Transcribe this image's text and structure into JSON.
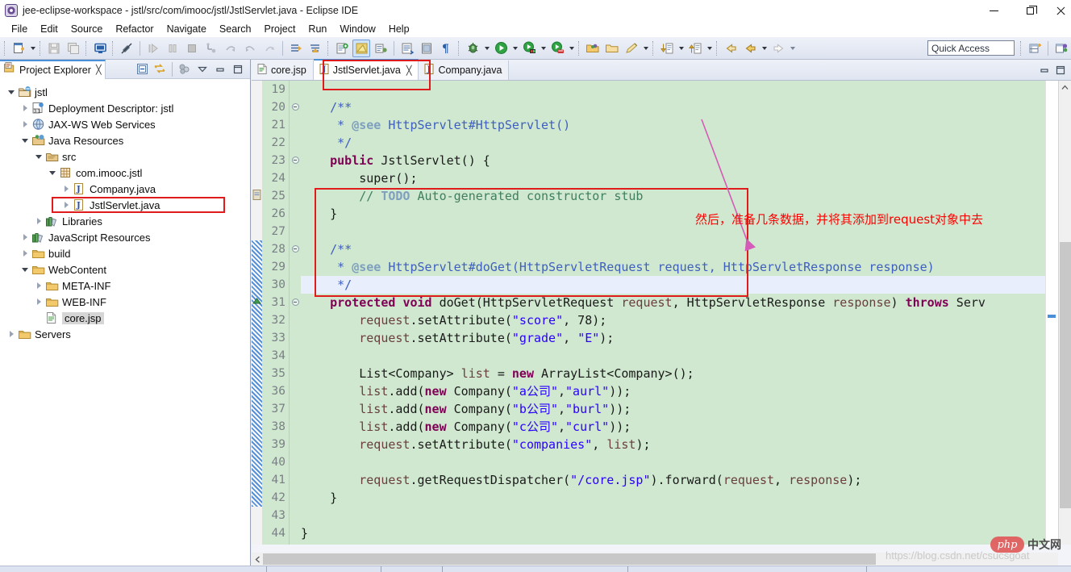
{
  "window": {
    "title": "jee-eclipse-workspace - jstl/src/com/imooc/jstl/JstlServlet.java - Eclipse IDE",
    "app_icon": "eclipse-icon",
    "controls": {
      "minimize": "minimize-icon",
      "maximize": "maximize-icon",
      "close": "close-icon"
    }
  },
  "menubar": {
    "items": [
      "File",
      "Edit",
      "Source",
      "Refactor",
      "Navigate",
      "Search",
      "Project",
      "Run",
      "Window",
      "Help"
    ]
  },
  "toolbar": {
    "quick_access_placeholder": "Quick Access",
    "buttons": [
      "new-wizard-icon",
      "new-dropdown-caret",
      "save-icon",
      "save-all-icon",
      "new-console-icon",
      "toggle-breakpoint-icon",
      "step-over-icon",
      "pause-icon",
      "terminate-icon",
      "step-into-icon",
      "step-return-icon",
      "resume-icon",
      "step-filter-icon",
      "next-annotation-icon",
      "previous-annotation-icon",
      "open-type-icon",
      "open-task-icon",
      "show-whitespace-icon",
      "debug-icon",
      "debug-caret",
      "run-icon",
      "run-caret",
      "run-server-icon",
      "server-caret",
      "profile-icon",
      "profile-caret",
      "open-folder-icon",
      "external-tools-icon",
      "pencil-icon",
      "pencil-caret",
      "import-icon",
      "import-caret",
      "export-icon",
      "export-caret",
      "back-icon",
      "back-history-icon",
      "back-caret",
      "forward-icon",
      "forward-caret",
      "new-perspective-icon",
      "open-perspective-icon"
    ]
  },
  "project_explorer": {
    "tab_label": "Project Explorer",
    "tab_icon": "project-explorer-icon",
    "tab_close": "╳",
    "tools": [
      "collapse-all-icon",
      "link-with-editor-icon",
      "view-menu-dots-icon",
      "filter-caret-icon",
      "minimize-view-icon",
      "maximize-view-icon"
    ],
    "tree": [
      {
        "label": "jstl",
        "indent": 0,
        "twist": "down",
        "icon": "java-project-icon"
      },
      {
        "label": "Deployment Descriptor: jstl",
        "indent": 1,
        "twist": "right",
        "icon": "deployment-descriptor-icon"
      },
      {
        "label": "JAX-WS Web Services",
        "indent": 1,
        "twist": "right",
        "icon": "jaxws-icon"
      },
      {
        "label": "Java Resources",
        "indent": 1,
        "twist": "down",
        "icon": "java-resources-icon"
      },
      {
        "label": "src",
        "indent": 2,
        "twist": "down",
        "icon": "source-folder-icon"
      },
      {
        "label": "com.imooc.jstl",
        "indent": 3,
        "twist": "down",
        "icon": "package-icon"
      },
      {
        "label": "Company.java",
        "indent": 4,
        "twist": "right",
        "icon": "java-file-icon"
      },
      {
        "label": "JstlServlet.java",
        "indent": 4,
        "twist": "right",
        "icon": "java-file-icon",
        "highlighted": true
      },
      {
        "label": "Libraries",
        "indent": 2,
        "twist": "right",
        "icon": "libraries-icon"
      },
      {
        "label": "JavaScript Resources",
        "indent": 1,
        "twist": "right",
        "icon": "libraries-icon"
      },
      {
        "label": "build",
        "indent": 1,
        "twist": "right",
        "icon": "folder-icon"
      },
      {
        "label": "WebContent",
        "indent": 1,
        "twist": "down",
        "icon": "folder-icon"
      },
      {
        "label": "META-INF",
        "indent": 2,
        "twist": "right",
        "icon": "folder-icon"
      },
      {
        "label": "WEB-INF",
        "indent": 2,
        "twist": "right",
        "icon": "folder-icon"
      },
      {
        "label": "core.jsp",
        "indent": 2,
        "twist": "none",
        "icon": "jsp-file-icon",
        "selected": true
      },
      {
        "label": "Servers",
        "indent": 0,
        "twist": "right",
        "icon": "folder-icon"
      }
    ]
  },
  "editor": {
    "tabs": [
      {
        "label": "core.jsp",
        "icon": "jsp-file-icon",
        "active": false,
        "closable": false
      },
      {
        "label": "JstlServlet.java",
        "icon": "java-file-icon",
        "active": true,
        "closable": true,
        "close_glyph": "╳",
        "highlighted": true
      },
      {
        "label": "Company.java",
        "icon": "java-file-icon",
        "active": false,
        "closable": false
      }
    ],
    "tools": [
      "minimize-editor-icon",
      "maximize-editor-icon"
    ],
    "first_visible_line": 19,
    "last_visible_line": 44,
    "caret_line": 30,
    "highlighted_line": 30,
    "folded_lines": [
      20,
      23,
      28,
      31
    ],
    "lines": [
      {
        "n": 19,
        "text": ""
      },
      {
        "n": 20,
        "text": "    /**"
      },
      {
        "n": 21,
        "text": "     * @see HttpServlet#HttpServlet()"
      },
      {
        "n": 22,
        "text": "     */"
      },
      {
        "n": 23,
        "text": "    public JstlServlet() {"
      },
      {
        "n": 24,
        "text": "        super();"
      },
      {
        "n": 25,
        "text": "        // TODO Auto-generated constructor stub"
      },
      {
        "n": 26,
        "text": "    }"
      },
      {
        "n": 27,
        "text": ""
      },
      {
        "n": 28,
        "text": "    /**"
      },
      {
        "n": 29,
        "text": "     * @see HttpServlet#doGet(HttpServletRequest request, HttpServletResponse response)"
      },
      {
        "n": 30,
        "text": "     */"
      },
      {
        "n": 31,
        "text": "    protected void doGet(HttpServletRequest request, HttpServletResponse response) throws Serv"
      },
      {
        "n": 32,
        "text": "        request.setAttribute(\"score\", 78);"
      },
      {
        "n": 33,
        "text": "        request.setAttribute(\"grade\", \"E\");"
      },
      {
        "n": 34,
        "text": ""
      },
      {
        "n": 35,
        "text": "        List<Company> list = new ArrayList<Company>();"
      },
      {
        "n": 36,
        "text": "        list.add(new Company(\"a公司\",\"aurl\"));"
      },
      {
        "n": 37,
        "text": "        list.add(new Company(\"b公司\",\"burl\"));"
      },
      {
        "n": 38,
        "text": "        list.add(new Company(\"c公司\",\"curl\"));"
      },
      {
        "n": 39,
        "text": "        request.setAttribute(\"companies\", list);"
      },
      {
        "n": 40,
        "text": ""
      },
      {
        "n": 41,
        "text": "        request.getRequestDispatcher(\"/core.jsp\").forward(request, response);"
      },
      {
        "n": 42,
        "text": "    }"
      },
      {
        "n": 43,
        "text": ""
      },
      {
        "n": 44,
        "text": "}"
      }
    ]
  },
  "annotation": {
    "text": "然后，准备几条数据，并将其添加到request对象中去",
    "color": "#ff0000",
    "arrow_color": "#d45bb8"
  },
  "watermarks": {
    "php_badge": "php",
    "php_cn": "中文网",
    "url": "https://blog.csdn.net/csucsgoat"
  },
  "colors": {
    "editor_background": "#cfe8cf",
    "highlight_line": "#e8eefc",
    "redbox": "#e01b1b",
    "accent": "#4a90d9",
    "keyword": "#7f0055",
    "string": "#2a00ff",
    "comment": "#3f7f5f",
    "javadoc": "#3f5fbf"
  }
}
